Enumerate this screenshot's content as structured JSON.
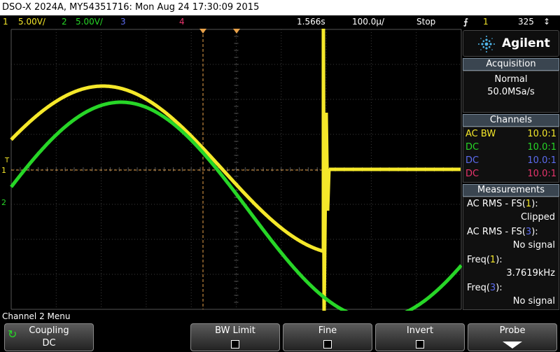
{
  "title": "DSO-X 2024A, MY54351716: Mon Aug 24 17:30:09 2015",
  "status": {
    "ch1_num": "1",
    "ch1_scale": "5.00V/",
    "ch2_num": "2",
    "ch2_scale": "5.00V/",
    "ch3_num": "3",
    "ch4_num": "4",
    "trigger_delay": "1.566s",
    "timebase": "100.0µ/",
    "run_state": "Stop",
    "trig_source": "1",
    "trig_level": "325"
  },
  "colors": {
    "ch1": "#f5e82a",
    "ch2": "#27d627",
    "ch3": "#5c6cf0",
    "ch4": "#e8346c",
    "trigger": "#e8a24a"
  },
  "panel": {
    "brand": "Agilent",
    "acquisition": {
      "header": "Acquisition",
      "mode": "Normal",
      "rate": "50.0MSa/s"
    },
    "channels": {
      "header": "Channels",
      "rows": [
        {
          "coupling": "AC BW",
          "probe": "10.0:1"
        },
        {
          "coupling": "DC",
          "probe": "10.0:1"
        },
        {
          "coupling": "DC",
          "probe": "10.0:1"
        },
        {
          "coupling": "DC",
          "probe": "10.0:1"
        }
      ]
    },
    "measurements": {
      "header": "Measurements",
      "m1_label": "AC RMS - FS(",
      "m1_ch": "1",
      "m1_close": "):",
      "m1_value": "Clipped",
      "m2_label": "AC RMS - FS(",
      "m2_ch": "3",
      "m2_close": "):",
      "m2_value": "No signal",
      "m3_label": "Freq(",
      "m3_ch": "1",
      "m3_close": "):",
      "m3_value": "3.7619kHz",
      "m4_label": "Freq(",
      "m4_ch": "3",
      "m4_close": "):",
      "m4_value": "No signal"
    }
  },
  "graticule": {
    "trig_marker": "T",
    "ch1_marker": "1",
    "ch2_marker": "2"
  },
  "menu": {
    "title": "Channel 2 Menu",
    "coupling_label": "Coupling",
    "coupling_value": "DC",
    "bw_limit_label": "BW Limit",
    "fine_label": "Fine",
    "invert_label": "Invert",
    "probe_label": "Probe"
  }
}
